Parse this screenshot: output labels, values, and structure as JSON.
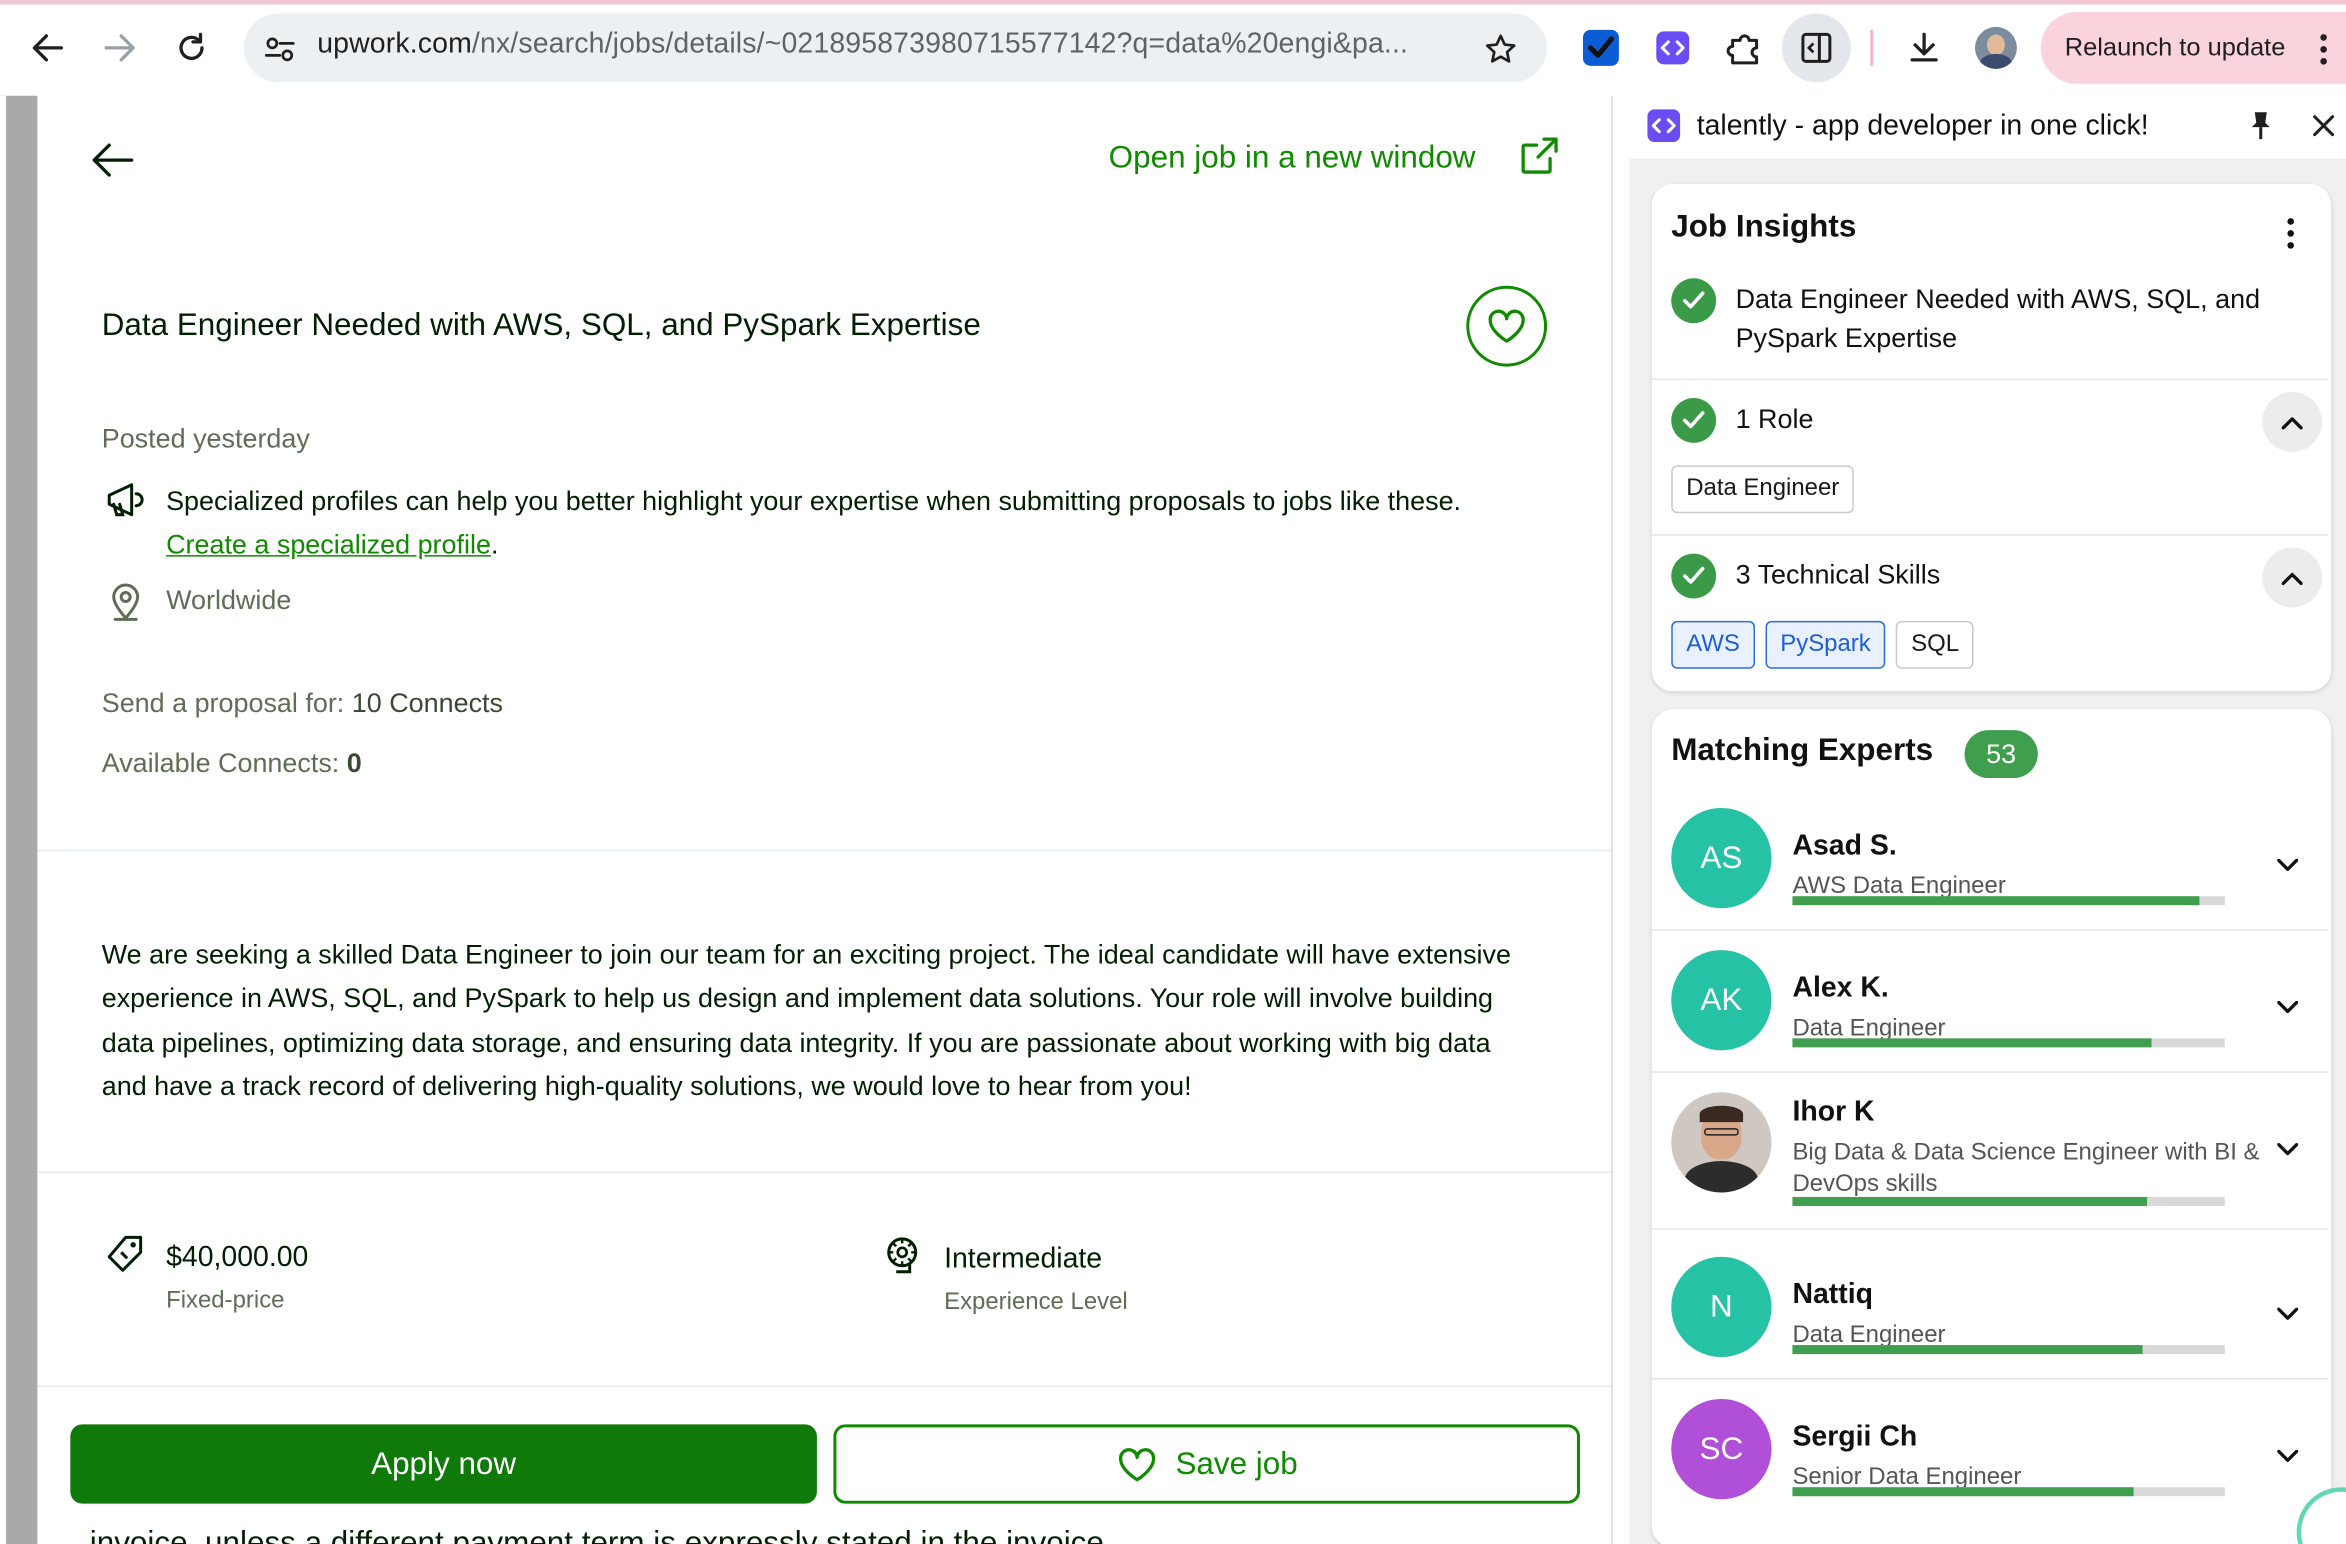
{
  "browser": {
    "url_host": "upwork.com",
    "url_path": "/nx/search/jobs/details/~021895873980715577142?q=data%20engi&pa...",
    "relaunch_label": "Relaunch to update"
  },
  "job": {
    "back_label": "",
    "open_new_window": "Open job in a new window",
    "title": "Data Engineer Needed with AWS, SQL, and PySpark Expertise",
    "posted": "Posted yesterday",
    "specialized_text": "Specialized profiles can help you better highlight your expertise when submitting proposals to jobs like these.",
    "specialized_link": "Create a specialized profile",
    "specialized_period": ".",
    "location": "Worldwide",
    "proposal_label": "Send a proposal for:",
    "proposal_value": "10 Connects",
    "available_label": "Available Connects:",
    "available_value": "0",
    "description": "We are seeking a skilled Data Engineer to join our team for an exciting project. The ideal candidate will have extensive experience in AWS, SQL, and PySpark to help us design and implement data solutions. Your role will involve building data pipelines, optimizing data storage, and ensuring data integrity. If you are passionate about working with big data and have a track record of delivering high-quality solutions, we would love to hear from you!",
    "price": "$40,000.00",
    "price_type": "Fixed-price",
    "level": "Intermediate",
    "level_label": "Experience Level",
    "apply_label": "Apply now",
    "save_label": "Save job",
    "bottom_cut_text": "invoice, unless a different payment term is expressly stated in the invoice"
  },
  "talently": {
    "header_title": "talently - app developer in one click!",
    "insights_title": "Job Insights",
    "insight_job_title": "Data Engineer Needed with AWS, SQL, and PySpark Expertise",
    "roles_label": "1 Role",
    "roles": [
      "Data Engineer"
    ],
    "skills_label": "3 Technical Skills",
    "skills": [
      {
        "name": "AWS",
        "highlight": true
      },
      {
        "name": "PySpark",
        "highlight": true
      },
      {
        "name": "SQL",
        "highlight": false
      }
    ],
    "experts_title": "Matching Experts",
    "experts_count": "53",
    "experts": [
      {
        "initials": "AS",
        "name": "Asad S.",
        "role": "AWS Data Engineer",
        "match": 0.94,
        "color": "#26c2a5"
      },
      {
        "initials": "AK",
        "name": "Alex K.",
        "role": "Data Engineer",
        "match": 0.83,
        "color": "#26c2a5"
      },
      {
        "initials": "",
        "name": "Ihor K",
        "role": "Big Data & Data Science Engineer with BI & DevOps skills",
        "match": 0.82,
        "color": "#cfc8c2",
        "photo": true
      },
      {
        "initials": "N",
        "name": "Nattiq",
        "role": "Data Engineer",
        "match": 0.81,
        "color": "#26c2a5"
      },
      {
        "initials": "SC",
        "name": "Sergii Ch",
        "role": "Senior Data Engineer",
        "match": 0.79,
        "color": "#b04fd8"
      }
    ]
  },
  "colors": {
    "upwork_green": "#108a00",
    "apply_bg": "#0f7a0a",
    "talently_check": "#3a9a48",
    "chip_blue": "#1f5fd6"
  }
}
